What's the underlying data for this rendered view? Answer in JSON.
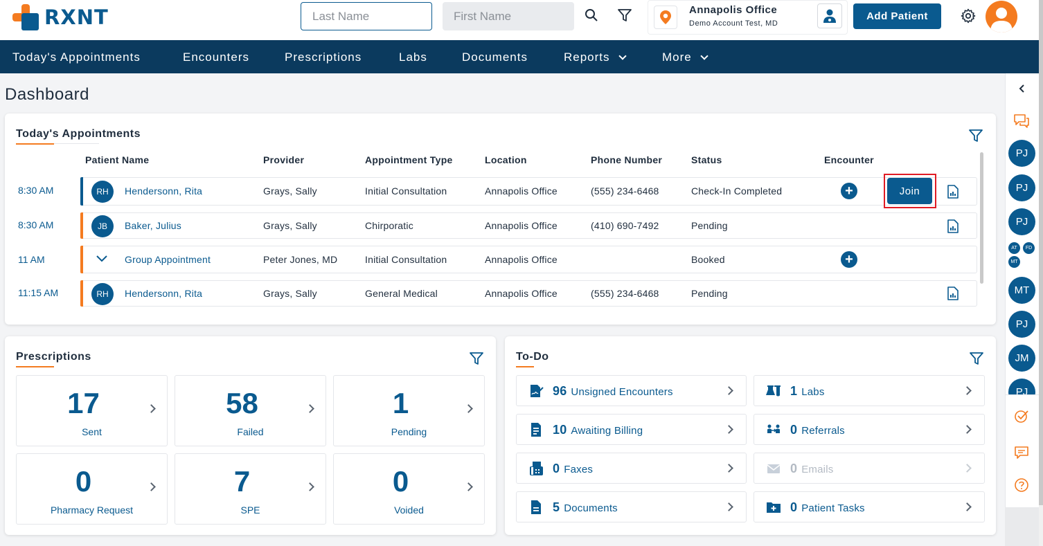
{
  "app": {
    "logo_text": "RXNT"
  },
  "header": {
    "last_name_placeholder": "Last Name",
    "first_name_placeholder": "First Name",
    "location_name": "Annapolis Office",
    "location_account": "Demo Account Test, MD",
    "add_patient_label": "Add Patient"
  },
  "nav": {
    "items": [
      "Today's Appointments",
      "Encounters",
      "Prescriptions",
      "Labs",
      "Documents",
      "Reports",
      "More"
    ]
  },
  "page": {
    "title": "Dashboard"
  },
  "appointments": {
    "title": "Today's Appointments",
    "columns": [
      "Patient Name",
      "Provider",
      "Appointment Type",
      "Location",
      "Phone Number",
      "Status",
      "Encounter"
    ],
    "join_label": "Join",
    "rows": [
      {
        "time": "8:30 AM",
        "initials": "RH",
        "patient": "Hendersonn, Rita",
        "provider": "Grays, Sally",
        "type": "Initial Consultation",
        "location": "Annapolis Office",
        "phone": "(555) 234-6468",
        "status": "Check-In Completed"
      },
      {
        "time": "8:30 AM",
        "initials": "JB",
        "patient": "Baker, Julius",
        "provider": "Grays, Sally",
        "type": "Chirporatic",
        "location": "Annapolis Office",
        "phone": "(410) 690-7492",
        "status": "Pending"
      },
      {
        "time": "11 AM",
        "initials": "",
        "patient": "Group Appointment",
        "provider": "Peter Jones, MD",
        "type": "Initial Consultation",
        "location": "Annapolis Office",
        "phone": "",
        "status": "Booked"
      },
      {
        "time": "11:15 AM",
        "initials": "RH",
        "patient": "Hendersonn, Rita",
        "provider": "Grays, Sally",
        "type": "General Medical",
        "location": "Annapolis Office",
        "phone": "(555) 234-6468",
        "status": "Pending"
      }
    ]
  },
  "prescriptions": {
    "title": "Prescriptions",
    "tiles": [
      {
        "value": "17",
        "label": "Sent"
      },
      {
        "value": "58",
        "label": "Failed"
      },
      {
        "value": "1",
        "label": "Pending"
      },
      {
        "value": "0",
        "label": "Pharmacy Request"
      },
      {
        "value": "7",
        "label": "SPE"
      },
      {
        "value": "0",
        "label": "Voided"
      }
    ]
  },
  "todo": {
    "title": "To-Do",
    "items": [
      {
        "count": "96",
        "label": "Unsigned Encounters",
        "icon": "signature-icon"
      },
      {
        "count": "1",
        "label": "Labs",
        "icon": "flask-icon"
      },
      {
        "count": "10",
        "label": "Awaiting Billing",
        "icon": "invoice-icon"
      },
      {
        "count": "0",
        "label": "Referrals",
        "icon": "referral-icon"
      },
      {
        "count": "0",
        "label": "Faxes",
        "icon": "fax-icon"
      },
      {
        "count": "0",
        "label": "Emails",
        "icon": "envelope-icon"
      },
      {
        "count": "5",
        "label": "Documents",
        "icon": "document-icon"
      },
      {
        "count": "0",
        "label": "Patient Tasks",
        "icon": "folder-plus-icon"
      }
    ]
  },
  "rail": {
    "avatars": [
      "PJ",
      "PJ",
      "PJ",
      "MT",
      "PJ",
      "JM",
      "PJ"
    ],
    "mini_avatars": [
      "AT",
      "FD",
      "MT"
    ]
  },
  "colors": {
    "brand_blue": "#0a5a8f",
    "nav_bg": "#0b3a5e",
    "accent_orange": "#f47b20",
    "highlight_red": "#e01b24"
  }
}
